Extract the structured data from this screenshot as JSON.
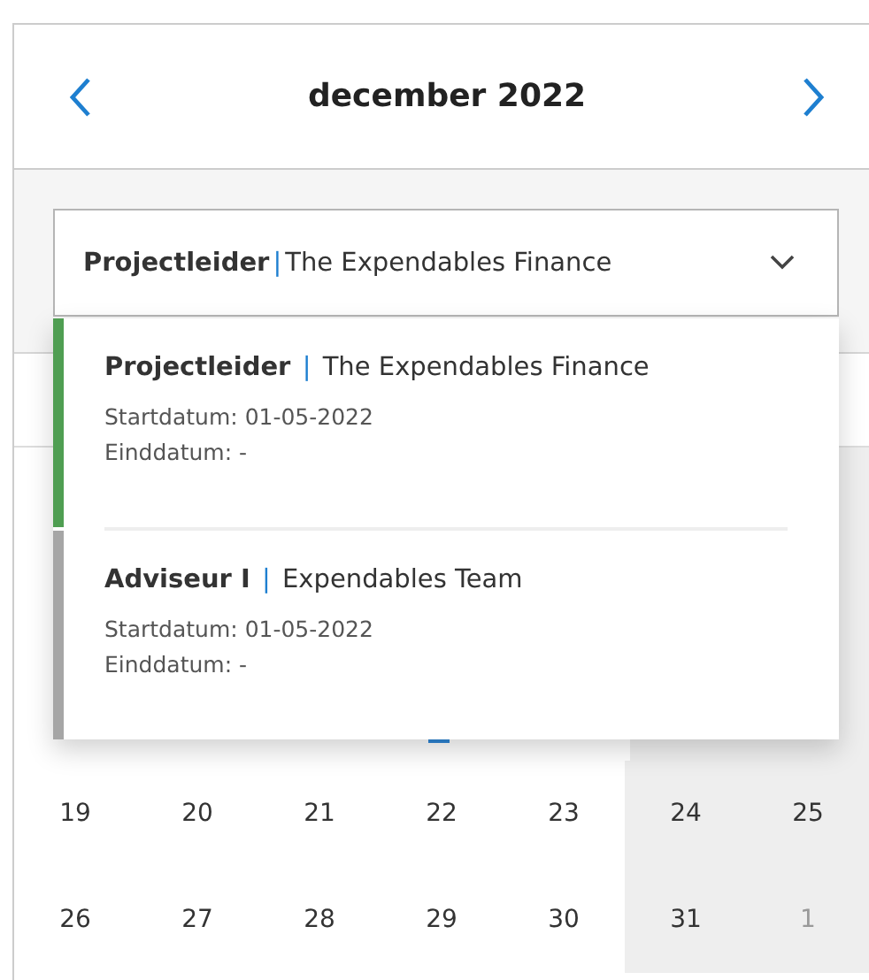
{
  "header": {
    "title": "december 2022"
  },
  "select": {
    "role": "Projectleider",
    "separator": "|",
    "organization": "The Expendables Finance",
    "expanded": true
  },
  "options": [
    {
      "role": "Projectleider",
      "separator": "|",
      "organization": "The Expendables Finance",
      "start": "Startdatum: 01-05-2022",
      "end": "Einddatum: -",
      "color": "#4f9e52"
    },
    {
      "role": "Adviseur I",
      "separator": "|",
      "organization": "Expendables Team",
      "start": "Startdatum: 01-05-2022",
      "end": "Einddatum: -",
      "color": "#a6a6a6"
    }
  ],
  "weeks": [
    [
      {
        "label": "19",
        "weekend": false,
        "other_month": false
      },
      {
        "label": "20",
        "weekend": false,
        "other_month": false
      },
      {
        "label": "21",
        "weekend": false,
        "other_month": false
      },
      {
        "label": "22",
        "weekend": false,
        "other_month": false
      },
      {
        "label": "23",
        "weekend": false,
        "other_month": false
      },
      {
        "label": "24",
        "weekend": true,
        "other_month": false
      },
      {
        "label": "25",
        "weekend": true,
        "other_month": false
      }
    ],
    [
      {
        "label": "26",
        "weekend": false,
        "other_month": false
      },
      {
        "label": "27",
        "weekend": false,
        "other_month": false
      },
      {
        "label": "28",
        "weekend": false,
        "other_month": false
      },
      {
        "label": "29",
        "weekend": false,
        "other_month": false
      },
      {
        "label": "30",
        "weekend": false,
        "other_month": false
      },
      {
        "label": "31",
        "weekend": true,
        "other_month": false
      },
      {
        "label": "1",
        "weekend": true,
        "other_month": true
      }
    ]
  ]
}
